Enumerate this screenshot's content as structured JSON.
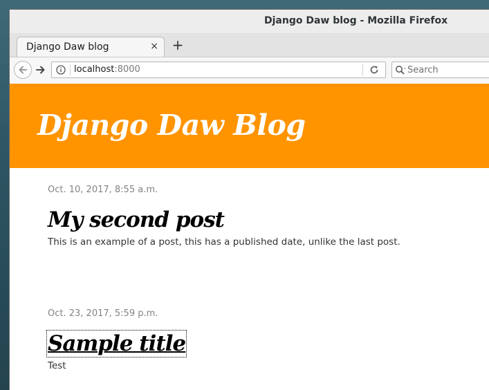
{
  "window": {
    "title": "Django Daw blog - Mozilla Firefox"
  },
  "tabs": [
    {
      "label": "Django Daw blog",
      "close_glyph": "×"
    }
  ],
  "newtab_glyph": "+",
  "navbar": {
    "url_host": "localhost",
    "url_port": ":8000",
    "search_placeholder": "Search"
  },
  "blog": {
    "site_title": "Django Daw Blog",
    "posts": [
      {
        "date": "Oct. 10, 2017, 8:55 a.m.",
        "title": "My second post",
        "text": "This is an example of a post, this has a published date, unlike the last post."
      },
      {
        "date": "Oct. 23, 2017, 5:59 p.m.",
        "title": "Sample title",
        "text": "Test"
      }
    ]
  },
  "colors": {
    "header_bg": "#ff9400",
    "header_text": "#ffffff",
    "date_text": "#838383"
  },
  "icons": {
    "back": "back-arrow-icon",
    "forward": "forward-arrow-icon",
    "info": "info-icon",
    "reload": "reload-icon",
    "search": "search-icon"
  }
}
